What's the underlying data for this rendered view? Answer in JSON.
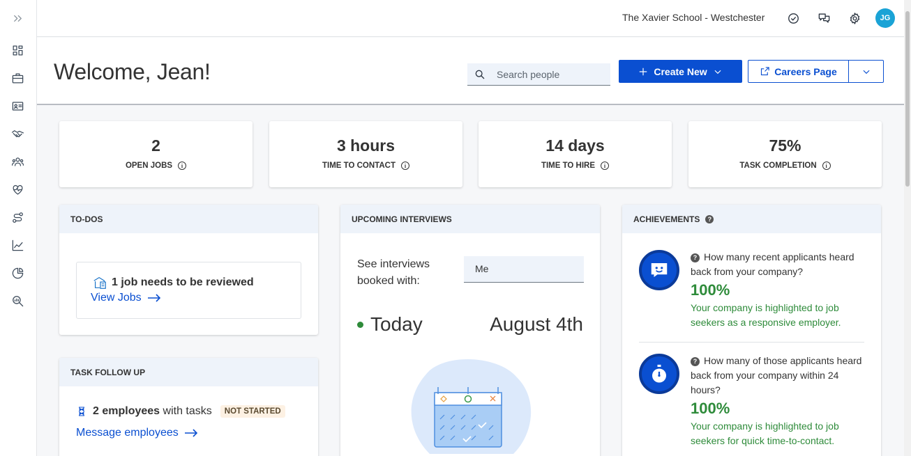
{
  "topbar": {
    "school_name": "The Xavier School - Westchester",
    "avatar_initials": "JG"
  },
  "sidebar": {
    "items": [
      "expand-icon",
      "dashboard-icon",
      "briefcase-icon",
      "id-card-icon",
      "handshake-icon",
      "people-icon",
      "heart-pulse-icon",
      "workflow-icon",
      "line-chart-icon",
      "pie-chart-icon",
      "search-analytics-icon"
    ]
  },
  "header": {
    "welcome": "Welcome, Jean!",
    "search_placeholder": "Search people",
    "create_new_label": "Create New",
    "careers_page_label": "Careers Page"
  },
  "stats": [
    {
      "value": "2",
      "label": "OPEN JOBS"
    },
    {
      "value": "3 hours",
      "label": "TIME TO CONTACT"
    },
    {
      "value": "14 days",
      "label": "TIME TO HIRE"
    },
    {
      "value": "75%",
      "label": "TASK COMPLETION"
    }
  ],
  "todos": {
    "title": "TO-DOS",
    "item_text": "1 job needs to be reviewed",
    "link_label": "View Jobs"
  },
  "task_follow_up": {
    "title": "TASK FOLLOW UP",
    "count_text": "2 employees",
    "suffix_text": "with tasks",
    "badge": "NOT STARTED",
    "link_label": "Message employees"
  },
  "interviews": {
    "title": "UPCOMING INTERVIEWS",
    "label_line1": "See interviews",
    "label_line2": "booked with:",
    "filter_value": "Me",
    "today_label": "Today",
    "date_label": "August 4th"
  },
  "achievements": {
    "title": "ACHIEVEMENTS",
    "items": [
      {
        "question": "How many recent applicants heard back from your company?",
        "percent": "100%",
        "description": "Your company is highlighted to job seekers as a responsive employer."
      },
      {
        "question": "How many of those applicants heard back from your company within 24 hours?",
        "percent": "100%",
        "description": "Your company is highlighted to job seekers for quick time-to-contact."
      }
    ]
  },
  "colors": {
    "primary": "#0a4fd1",
    "success": "#2e8b3a",
    "avatar": "#1aa3d6",
    "panel_header": "#eef3fa"
  }
}
